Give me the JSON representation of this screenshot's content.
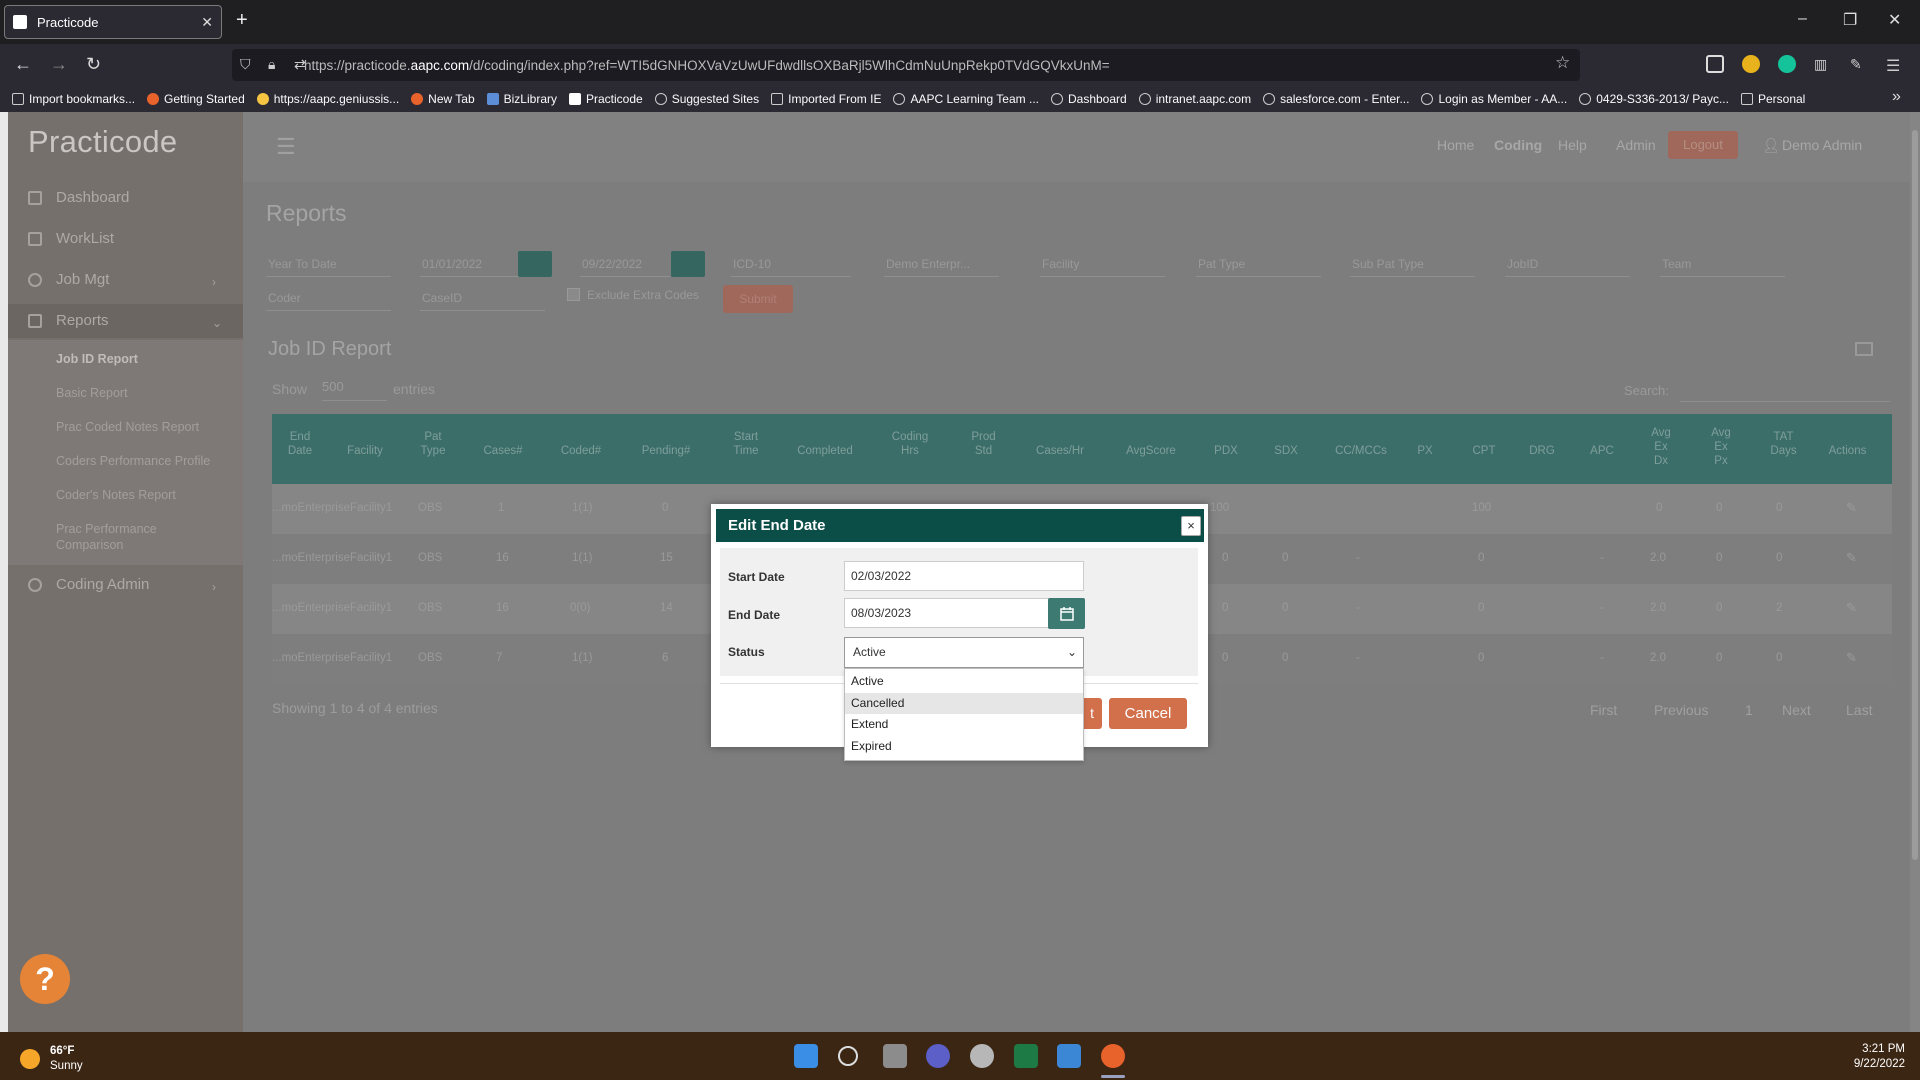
{
  "browser": {
    "tab_title": "Practicode",
    "url_prefix": "https://practicode.",
    "url_domain": "aapc.com",
    "url_rest": "/d/coding/index.php?ref=WTI5dGNHOXVaVzUwUFdwdllsOXBaRjl5WlhCdmNuUnpRekp0TVdGQVkxUnM=",
    "bookmarks": [
      "Import bookmarks...",
      "Getting Started",
      "https://aapc.geniussis...",
      "New Tab",
      "BizLibrary",
      "Practicode",
      "Suggested Sites",
      "Imported From IE",
      "AAPC Learning Team ...",
      "Dashboard",
      "intranet.aapc.com",
      "salesforce.com - Enter...",
      "Login as Member - AA...",
      "0429-S336-2013/ Payc...",
      "Personal"
    ]
  },
  "app": {
    "logo": "Practicode",
    "sidebar": {
      "items": [
        "Dashboard",
        "WorkList",
        "Job Mgt",
        "Reports",
        "Coding Admin"
      ],
      "subitems": [
        "Job ID Report",
        "Basic Report",
        "Prac Coded Notes Report",
        "Coders Performance Profile",
        "Coder's Notes Report",
        "Prac Performance Comparison"
      ]
    },
    "topnav": {
      "home": "Home",
      "coding": "Coding",
      "help": "Help",
      "admin": "Admin",
      "logout": "Logout",
      "user": "Demo Admin"
    },
    "page_title": "Reports",
    "filters": {
      "range": "Year To Date",
      "start": "01/01/2022",
      "end": "09/22/2022",
      "code_set": "ICD-10",
      "enterprise": "Demo Enterpr...",
      "facility": "Facility",
      "pat_type": "Pat Type",
      "sub_pat_type": "Sub Pat Type",
      "jobid": "JobID",
      "team": "Team",
      "coder": "Coder",
      "caseid": "CaseID",
      "exclude": "Exclude Extra Codes",
      "submit": "Submit"
    },
    "report_title": "Job ID Report",
    "show_label": "Show",
    "show_value": "500",
    "entries_label": "entries",
    "search_label": "Search:",
    "columns": [
      "End Date",
      "Facility",
      "Pat Type",
      "Cases#",
      "Coded#",
      "Pending#",
      "Start Time",
      "Completed",
      "Coding Hrs",
      "Prod Std",
      "Cases/Hr",
      "AvgScore",
      "PDX",
      "SDX",
      "CC/MCCs",
      "PX",
      "CPT",
      "DRG",
      "APC",
      "Avg Ex Dx",
      "Avg Ex Px",
      "TAT Days",
      "Actions"
    ],
    "rows": [
      {
        "facility": "...moEnterpriseFacility1",
        "pat": "OBS",
        "cases": "1",
        "coded": "1(1)",
        "pending": "0",
        "pdx": "100",
        "cpt": "100",
        "a": "0",
        "b": "0",
        "c": "0"
      },
      {
        "facility": "...moEnterpriseFacility1",
        "pat": "OBS",
        "cases": "16",
        "coded": "1(1)",
        "pending": "15",
        "pdx": "0",
        "sdx": "0",
        "cc": "-",
        "cpt": "0",
        "apc": "-",
        "a": "2.0",
        "b": "0",
        "c": "0"
      },
      {
        "facility": "...moEnterpriseFacility1",
        "pat": "OBS",
        "cases": "16",
        "coded": "0(0)",
        "pending": "14",
        "pdx": "0",
        "sdx": "0",
        "cc": "-",
        "cpt": "0",
        "apc": "-",
        "a": "2.0",
        "b": "0",
        "c": "2"
      },
      {
        "facility": "...moEnterpriseFacility1",
        "pat": "OBS",
        "cases": "7",
        "coded": "1(1)",
        "pending": "6",
        "pdx": "0",
        "sdx": "0",
        "cc": "-",
        "cpt": "0",
        "apc": "-",
        "a": "2.0",
        "b": "0",
        "c": "0"
      }
    ],
    "showing": "Showing 1 to 4 of 4 entries",
    "pagination": [
      "First",
      "Previous",
      "1",
      "Next",
      "Last"
    ]
  },
  "modal": {
    "title": "Edit End Date",
    "close": "×",
    "start_label": "Start Date",
    "start_value": "02/03/2022",
    "end_label": "End Date",
    "end_value": "08/03/2023",
    "status_label": "Status",
    "status_value": "Active",
    "ok_label": "t",
    "cancel_label": "Cancel",
    "options": [
      "Active",
      "Cancelled",
      "Extend",
      "Expired"
    ]
  },
  "taskbar": {
    "temp": "66°F",
    "weather": "Sunny",
    "time": "3:21 PM",
    "date": "9/22/2022"
  },
  "colors": {
    "modal_header": "#0b4e48",
    "accent_button": "#d2704c",
    "taskbar": "#3b2614"
  }
}
